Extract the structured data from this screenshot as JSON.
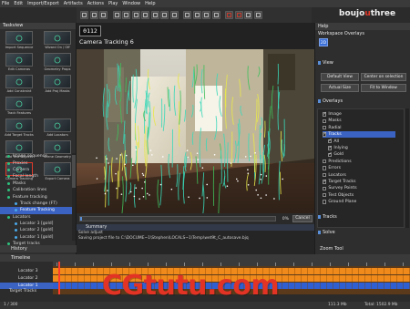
{
  "menu": [
    "File",
    "Edit",
    "Import/Export",
    "Artifacts",
    "Actions",
    "Play",
    "Window",
    "Help"
  ],
  "brand": {
    "part1": "boujo",
    "part2": "u",
    "part3": "three"
  },
  "taskview": {
    "title": "Taskview",
    "tasks": [
      {
        "label": "Import Sequence",
        "icon": "import-sequence-icon"
      },
      {
        "label": "Wizard On / Off",
        "icon": "wizard-icon"
      },
      {
        "label": "Edit Cameras",
        "icon": "edit-cameras-icon"
      },
      {
        "label": "Geometry Props",
        "icon": "geometry-props-icon"
      },
      {
        "label": "Add Constraint",
        "icon": "add-constraint-icon"
      },
      {
        "label": "Add Proj Masks",
        "icon": "add-masks-icon"
      },
      {
        "label": "Track Features",
        "icon": "track-features-icon"
      },
      {
        "label": "",
        "icon": ""
      },
      {
        "label": "Add Target Tracks",
        "icon": "add-target-tracks-icon"
      },
      {
        "label": "Add Locators",
        "icon": "add-locators-icon"
      },
      {
        "label": "Add Test Objects",
        "icon": "add-test-objects-icon"
      },
      {
        "label": "Scene Geometry",
        "icon": "scene-geometry-icon"
      },
      {
        "label": "Camera Tracking",
        "icon": "camera-tracking-icon"
      },
      {
        "label": "Export Camera",
        "icon": "export-camera-icon"
      }
    ],
    "tree": [
      {
        "label": "Image sequence",
        "level": 1,
        "selected": false
      },
      {
        "label": "Proxies",
        "level": 1,
        "selected": false
      },
      {
        "label": "Camera",
        "level": 1,
        "selected": false
      },
      {
        "label": "Focal length",
        "level": 1,
        "selected": false
      },
      {
        "label": "Masks",
        "level": 1,
        "selected": false
      },
      {
        "label": "Calibration lines",
        "level": 1,
        "selected": false
      },
      {
        "label": "Feature tracking",
        "level": 1,
        "selected": false
      },
      {
        "label": "Track change (FT)",
        "level": 2,
        "selected": false
      },
      {
        "label": "Feature Tracking",
        "level": 2,
        "selected": true
      },
      {
        "label": "Locators",
        "level": 1,
        "selected": false
      },
      {
        "label": "Locator 3 [gold]",
        "level": 2,
        "selected": false
      },
      {
        "label": "Locator 2 [gold]",
        "level": 2,
        "selected": false
      },
      {
        "label": "Locator 1 [gold]",
        "level": 2,
        "selected": false
      },
      {
        "label": "Target tracks",
        "level": 1,
        "selected": false
      }
    ],
    "history_label": "History"
  },
  "viewer": {
    "frame": "0112",
    "title": "Camera Tracking 6",
    "progress_percent": "0%",
    "progress_value": 0.01,
    "cancel_label": "Cancel",
    "summary_label": "Summary",
    "summary_lines": [
      "Solve adjust",
      "Saving project file to  C:\\DOCUME~1\\Stephen\\LOCALS~1\\Temp\\wet9t_C_autosave.bjq"
    ]
  },
  "right_panel": {
    "help": "Help",
    "workspace": "Workspace Overlays",
    "two_d": "2D",
    "view_label": "View",
    "buttons": {
      "default_view": "Default View",
      "center_on_selection": "Center on selection",
      "actual_size": "Actual Size",
      "fit_to_window": "Fit to Window"
    },
    "overlays_label": "Overlays",
    "overlays": [
      {
        "label": "Image",
        "checked": true,
        "level": 1,
        "selected": false
      },
      {
        "label": "Masks",
        "checked": false,
        "level": 1,
        "selected": false
      },
      {
        "label": "Radial",
        "checked": false,
        "level": 1,
        "selected": false
      },
      {
        "label": "Tracks",
        "checked": true,
        "level": 1,
        "selected": true
      },
      {
        "label": "All",
        "checked": true,
        "level": 2,
        "selected": false
      },
      {
        "label": "Inlying",
        "checked": true,
        "level": 2,
        "selected": false
      },
      {
        "label": "Gold",
        "checked": true,
        "level": 2,
        "selected": false
      },
      {
        "label": "Predictions",
        "checked": false,
        "level": 1,
        "selected": false
      },
      {
        "label": "Errors",
        "checked": false,
        "level": 1,
        "selected": false
      },
      {
        "label": "Locators",
        "checked": false,
        "level": 1,
        "selected": false
      },
      {
        "label": "Target Tracks",
        "checked": true,
        "level": 1,
        "selected": false
      },
      {
        "label": "Survey Points",
        "checked": false,
        "level": 1,
        "selected": false
      },
      {
        "label": "Test Objects",
        "checked": false,
        "level": 1,
        "selected": false
      },
      {
        "label": "Ground Plane",
        "checked": false,
        "level": 1,
        "selected": false
      }
    ],
    "tracks_section": "Tracks",
    "solve_section": "Solve",
    "zoom_tool": "Zoom Tool"
  },
  "timeline": {
    "title": "Timeline",
    "rows": [
      {
        "label": "Locator 3",
        "selected": false
      },
      {
        "label": "Locator 2",
        "selected": false
      },
      {
        "label": "Locator 1",
        "selected": true
      }
    ],
    "target_tracks": "Target Tracks"
  },
  "status": {
    "left": "1 / 300",
    "total": "Total: 1502.9 Mb",
    "coords": "111.3 Mb"
  },
  "watermark": "CGtutu.com",
  "colors": {
    "accent": "#e03a2a",
    "selection": "#3a63c4",
    "timeline_orange": "#f08a1a"
  }
}
